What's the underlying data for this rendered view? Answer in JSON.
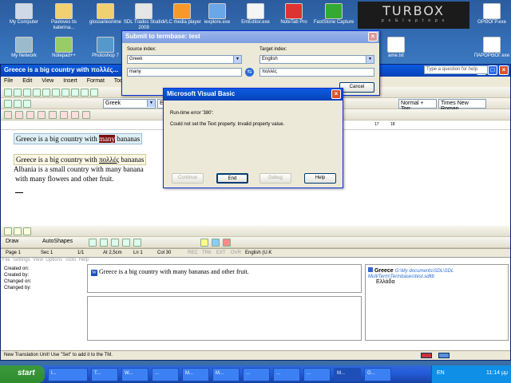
{
  "desktop": {
    "icons": [
      "My Computer",
      "Pavloves tis katerina...",
      "glossariesmine",
      "SDL Trados Studio 2009",
      "VLC media player",
      "iexplore.exe",
      "EmEditor.exe",
      "NoteTab Pro",
      "FastStone Capture",
      "ΟΡΘΟΓΡ.exe",
      "My Network",
      "Notepad++",
      "Photoshop 7",
      "ame.txt",
      "ΠΑΡΟΡΘΟΓ.exe"
    ],
    "turbo_logo": "TURBOX",
    "turbo_tagline": "p s & l a p t o p s",
    "turbo_url": "www.plaisio.gr"
  },
  "word": {
    "title": "Greece is a big country with πολλές...",
    "menu": [
      "File",
      "Edit",
      "View",
      "Insert",
      "Format",
      "Tools"
    ],
    "help_placeholder": "Type a question for help",
    "language_combo": "Greek",
    "language_combo2": "Eng",
    "style_combo": "Normal + Top: ",
    "font_combo": "Times New Roman",
    "ruler_marks": [
      "17",
      "18"
    ],
    "line1_pre": "Greece is a big country with ",
    "line1_sel": "many",
    "line1_post": " bananas",
    "line2_pre": "Greece is a big country with ",
    "line2_greek": "πολλές",
    "line2_post": " bananas",
    "line3": " Albania is a small country with many banana",
    "line4": "with many flowers and other fruit.",
    "drawbar": [
      "Draw",
      "AutoShapes"
    ],
    "status": {
      "page": "Page 1",
      "sec": "Sec 1",
      "pages": "1/1",
      "at": "At 2,5cm",
      "ln": "Ln 1",
      "col": "Col 30",
      "rec": "REC",
      "trk": "TRK",
      "ext": "EXT",
      "ovr": "OVR",
      "lang": "English (U.K"
    }
  },
  "tb_panel": {
    "menu": [
      "File",
      "Settings",
      "View",
      "Options",
      "Tools",
      "Help"
    ],
    "labels": [
      "Created on:",
      "Created by:",
      "Changed on:",
      "Changed by:"
    ],
    "source_text": "Greece is a big country with many bananas and other fruit.",
    "term_lang": "Greece",
    "term_path": "G:\\My documents\\SDL\\SDL MultiTerm\\Termbases\\test.sdltb",
    "term_target": "Ελλάδα",
    "status_msg": "New Translation Unit! Use \"Set\" to add it to the TM."
  },
  "submit_dialog": {
    "title": "Submit to termbase: test",
    "source_label": "Source index:",
    "target_label": "Target index:",
    "source_lang": "Greek",
    "target_lang": "English",
    "source_term": "many",
    "target_term": "πολλές",
    "cancel": "Cancel"
  },
  "vb_dialog": {
    "title": "Microsoft Visual Basic",
    "error_line": "Run-time error '380':",
    "message": "Could not set the Text property. Invalid property value.",
    "buttons": [
      "Continue",
      "End",
      "Debug",
      "Help"
    ]
  },
  "taskbar": {
    "start": "start",
    "tasks": [
      "I...",
      "T...",
      "W...",
      "...",
      "M...",
      "M...",
      "...",
      "...",
      "...",
      "M...",
      "G..."
    ],
    "lang": "EN",
    "clock": "11:14 μμ"
  }
}
